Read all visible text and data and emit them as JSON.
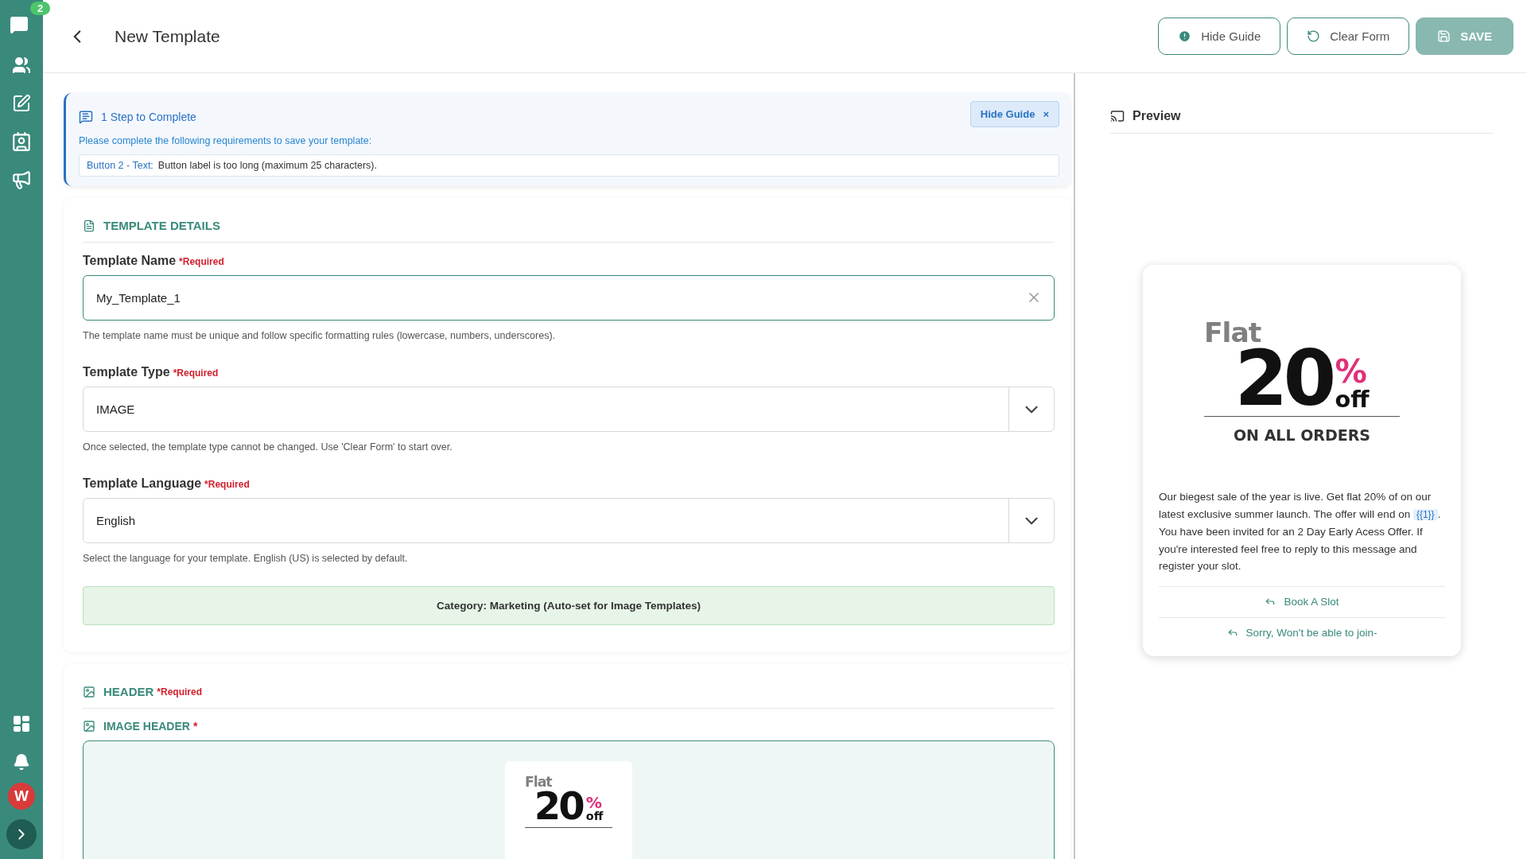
{
  "sidebar": {
    "chat_badge": "2",
    "avatar": "W"
  },
  "header": {
    "title": "New Template",
    "buttons": [
      {
        "kind": "guide",
        "label": "Hide Guide",
        "disabled": false
      },
      {
        "kind": "clear",
        "label": "Clear Form",
        "disabled": false
      },
      {
        "kind": "save",
        "label": "SAVE",
        "disabled": true
      }
    ]
  },
  "guide": {
    "title": "1 Step to Complete",
    "hide_button": "Hide Guide",
    "close": "×",
    "intro": "Please complete the following requirements to save your template:",
    "issues": [
      {
        "field": "Button 2 - Text:",
        "message": "Button label is too long (maximum 25 characters)."
      }
    ]
  },
  "template_details": {
    "heading": "TEMPLATE DETAILS",
    "fields": [
      {
        "kind": "text",
        "label": "Template Name",
        "required": "*Required",
        "value": "My_Template_1",
        "help": "The template name must be unique and follow specific formatting rules (lowercase, numbers, underscores)."
      },
      {
        "kind": "select",
        "label": "Template Type",
        "required": "*Required",
        "value": "IMAGE",
        "help": "Once selected, the template type cannot be changed. Use 'Clear Form' to start over."
      },
      {
        "kind": "select",
        "label": "Template Language",
        "required": "*Required",
        "value": "English",
        "help": "Select the language for your template. English (US) is selected by default."
      }
    ],
    "category": "Category: Marketing (Auto-set for Image Templates)"
  },
  "header_section": {
    "heading": "HEADER",
    "required": "*Required",
    "image_label": "IMAGE HEADER",
    "image_required": "*",
    "thumbnail": {
      "flat": "Flat",
      "amount": "20",
      "percent": "%",
      "off": "off"
    }
  },
  "preview": {
    "title": "Preview",
    "image": {
      "flat": "Flat",
      "amount": "20",
      "percent": "%",
      "off": "off",
      "tagline": "ON ALL ORDERS"
    },
    "body_before": "Our biegest sale of the year is live. Get flat 20% of on our latest exclusive summer launch. The offer will end on ",
    "variable": "{{1}}",
    "body_after": ". You have been invited for an 2 Day Early Acess Offer. If you're interested feel free to reply to this message and register your slot.",
    "buttons": [
      {
        "label": "Book A Slot"
      },
      {
        "label": "Sorry, Won't be able to join-"
      }
    ]
  }
}
